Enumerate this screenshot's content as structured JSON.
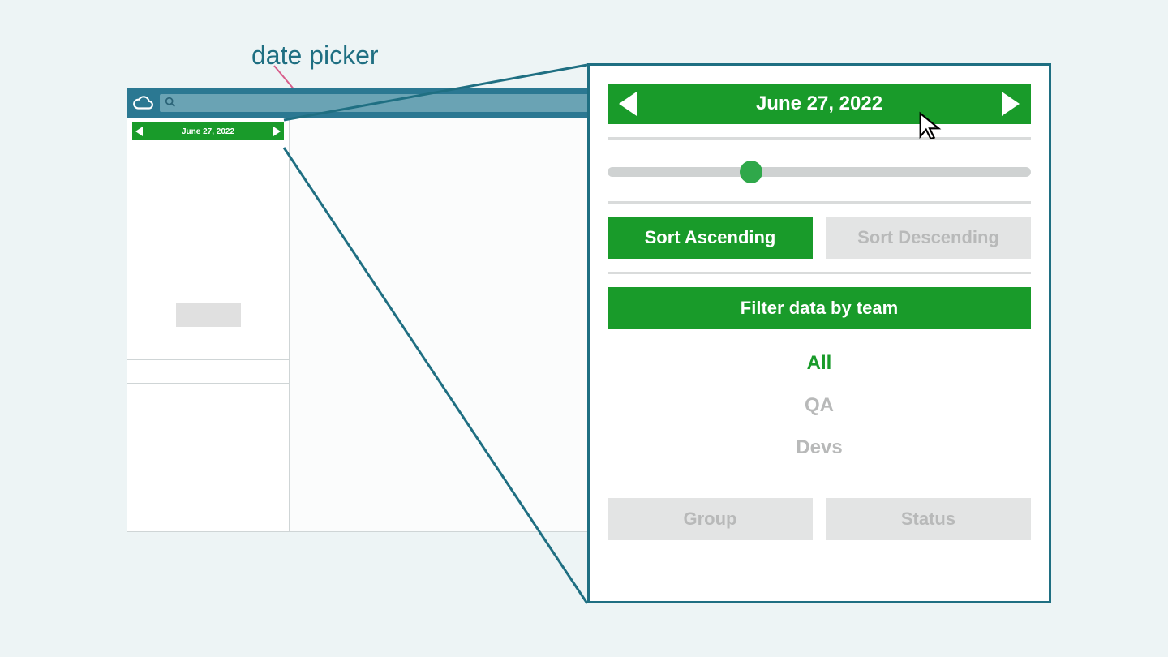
{
  "annotation": {
    "label": "date picker"
  },
  "app": {
    "date_strip": "June 27, 2022",
    "search_placeholder": ""
  },
  "zoom": {
    "date": "June 27, 2022",
    "slider_value_pct": 34,
    "sort_asc_label": "Sort Ascending",
    "sort_desc_label": "Sort Descending",
    "sort_active": "asc",
    "filter_header": "Filter data by team",
    "filter_options": [
      "All",
      "QA",
      "Devs"
    ],
    "filter_selected": "All",
    "bottom": {
      "group_label": "Group",
      "status_label": "Status"
    }
  }
}
